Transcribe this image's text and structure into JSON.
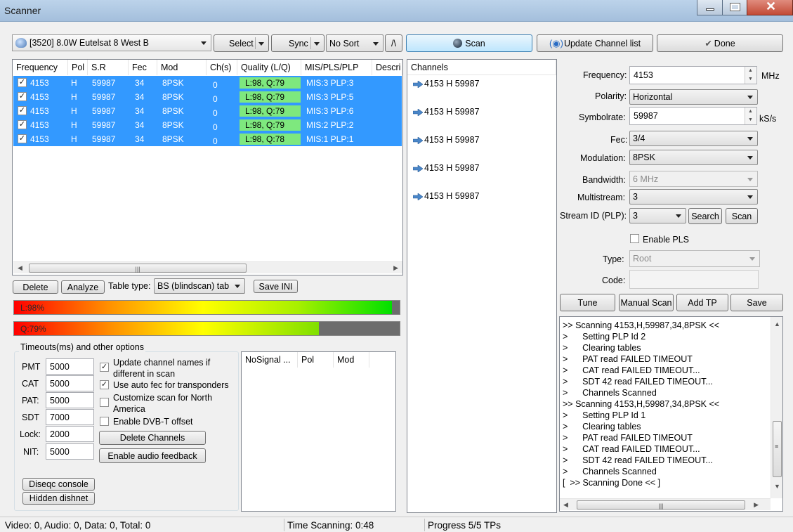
{
  "window": {
    "title": "Scanner"
  },
  "toolbar": {
    "satellite": "[3520]   8.0W  Eutelsat 8 West B",
    "select": "Select",
    "sync": "Sync",
    "sort": "No Sort",
    "sort_dir": "/\\",
    "scan": "Scan",
    "update_list": "Update Channel list",
    "done": "Done"
  },
  "table": {
    "headers": [
      "Frequency",
      "Pol",
      "S.R",
      "Fec",
      "Mod",
      "Ch(s)",
      "Quality (L/Q)",
      "MIS/PLS/PLP",
      "Descri"
    ],
    "rows": [
      {
        "freq": "4153",
        "pol": "H",
        "sr": "59987",
        "fec": "34",
        "mod": "8PSK",
        "chs": "0",
        "quality": "L:98, Q:79",
        "mis": "MIS:3 PLP:3"
      },
      {
        "freq": "4153",
        "pol": "H",
        "sr": "59987",
        "fec": "34",
        "mod": "8PSK",
        "chs": "0",
        "quality": "L:98, Q:79",
        "mis": "MIS:3 PLP:5"
      },
      {
        "freq": "4153",
        "pol": "H",
        "sr": "59987",
        "fec": "34",
        "mod": "8PSK",
        "chs": "0",
        "quality": "L:98, Q:79",
        "mis": "MIS:3 PLP:6"
      },
      {
        "freq": "4153",
        "pol": "H",
        "sr": "59987",
        "fec": "34",
        "mod": "8PSK",
        "chs": "0",
        "quality": "L:98, Q:79",
        "mis": "MIS:2 PLP:2"
      },
      {
        "freq": "4153",
        "pol": "H",
        "sr": "59987",
        "fec": "34",
        "mod": "8PSK",
        "chs": "0",
        "quality": "L:98, Q:78",
        "mis": "MIS:1 PLP:1"
      }
    ]
  },
  "actions": {
    "delete": "Delete",
    "analyze": "Analyze",
    "table_type_label": "Table type:",
    "table_type": "BS (blindscan) tab",
    "save_ini": "Save INI"
  },
  "meters": {
    "level_text": "L:98%",
    "level": 0.98,
    "quality_text": "Q:79%",
    "quality": 0.79
  },
  "options": {
    "title": "Timeouts(ms) and other options",
    "pmt_label": "PMT",
    "pmt": "5000",
    "cat_label": "CAT",
    "cat": "5000",
    "pat_label": "PAT:",
    "pat": "5000",
    "sdt_label": "SDT",
    "sdt": "7000",
    "lock_label": "Lock:",
    "lock": "2000",
    "nit_label": "NIT:",
    "nit": "5000",
    "chk_update_names": "Update channel names if different in scan",
    "chk_autofec": "Use auto fec for transponders",
    "chk_northam": "Customize scan for North America",
    "chk_dvbt": "Enable DVB-T offset",
    "delete_channels": "Delete Channels",
    "audio_feedback": "Enable audio feedback",
    "diseqc": "Diseqc console",
    "hidden_dish": "Hidden dishnet"
  },
  "nosignal": {
    "headers": [
      "NoSignal ...",
      "Pol",
      "Mod"
    ]
  },
  "channels": {
    "header": "Channels",
    "items": [
      "4153 H 59987",
      "4153 H 59987",
      "4153 H 59987",
      "4153 H 59987",
      "4153 H 59987"
    ]
  },
  "tuner": {
    "frequency_label": "Frequency:",
    "frequency": "4153",
    "mhz": "MHz",
    "polarity_label": "Polarity:",
    "polarity": "Horizontal",
    "symbolrate_label": "Symbolrate:",
    "symbolrate": "59987",
    "ksps": "kS/s",
    "fec_label": "Fec:",
    "fec": "3/4",
    "modulation_label": "Modulation:",
    "modulation": "8PSK",
    "bandwidth_label": "Bandwidth:",
    "bandwidth": "6 MHz",
    "multistream_label": "Multistream:",
    "multistream": "3",
    "streamid_label": "Stream ID (PLP):",
    "streamid": "3",
    "search": "Search",
    "scan": "Scan",
    "enable_pls": "Enable PLS",
    "type_label": "Type:",
    "type": "Root",
    "code_label": "Code:",
    "tune": "Tune",
    "manual_scan": "Manual Scan",
    "add_tp": "Add TP",
    "save": "Save"
  },
  "log": {
    "lines": [
      ">> Scanning 4153,H,59987,34,8PSK <<",
      ">      Setting PLP Id 2",
      ">      Clearing tables",
      ">      PAT read FAILED TIMEOUT",
      ">      CAT read FAILED TIMEOUT...",
      ">      SDT 42 read FAILED TIMEOUT...",
      ">      Channels Scanned",
      ">> Scanning 4153,H,59987,34,8PSK <<",
      ">      Setting PLP Id 1",
      ">      Clearing tables",
      ">      PAT read FAILED TIMEOUT",
      ">      CAT read FAILED TIMEOUT...",
      ">      SDT 42 read FAILED TIMEOUT...",
      ">      Channels Scanned",
      "[  >> Scanning Done << ]"
    ]
  },
  "status": {
    "counts": "Video: 0, Audio: 0, Data: 0, Total: 0",
    "time": "Time Scanning: 0:48",
    "progress": "Progress 5/5 TPs"
  }
}
